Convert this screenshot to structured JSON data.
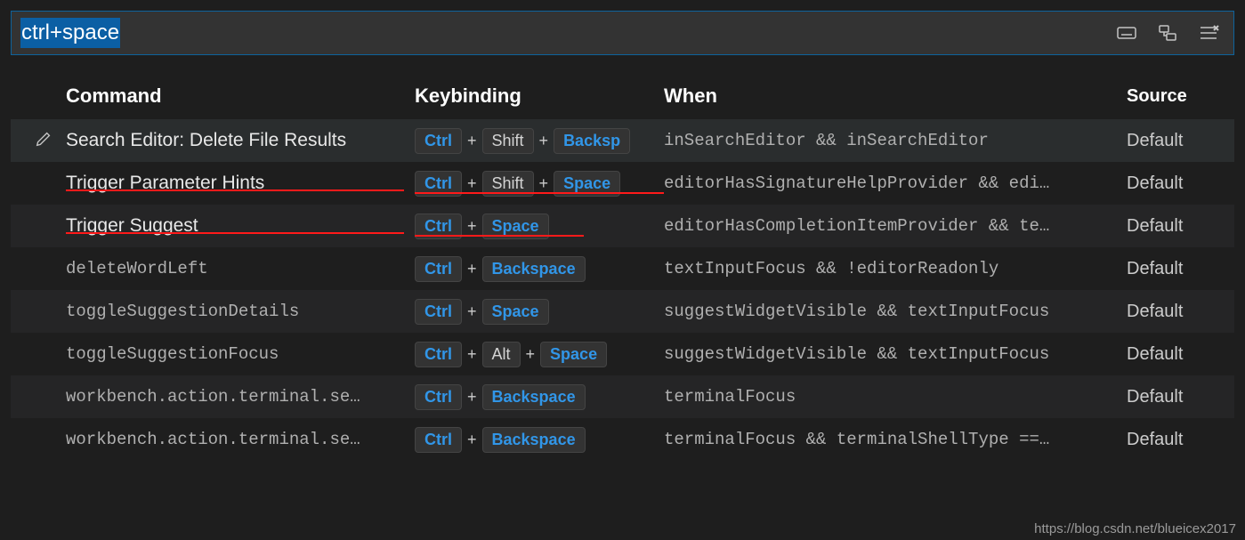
{
  "search": {
    "value": "ctrl+space"
  },
  "columns": {
    "command": "Command",
    "keybinding": "Keybinding",
    "when": "When",
    "source": "Source"
  },
  "rows": [
    {
      "command": "Search Editor: Delete File Results",
      "isId": false,
      "keys": [
        {
          "label": "Ctrl",
          "hl": true
        },
        {
          "label": "+",
          "plus": true
        },
        {
          "label": "Shift",
          "hl": false
        },
        {
          "label": "+",
          "plus": true
        },
        {
          "label": "Backsp",
          "hl": true
        }
      ],
      "when": "inSearchEditor && inSearchEditor",
      "source": "Default",
      "hovered": true,
      "underlineCmd": 0,
      "underlineKey": 0
    },
    {
      "command": "Trigger Parameter Hints",
      "isId": false,
      "keys": [
        {
          "label": "Ctrl",
          "hl": true
        },
        {
          "label": "+",
          "plus": true
        },
        {
          "label": "Shift",
          "hl": false
        },
        {
          "label": "+",
          "plus": true
        },
        {
          "label": "Space",
          "hl": true
        }
      ],
      "when": "editorHasSignatureHelpProvider && edi…",
      "source": "Default",
      "underlineCmd": 380,
      "underlineKey": 280
    },
    {
      "command": "Trigger Suggest",
      "isId": false,
      "keys": [
        {
          "label": "Ctrl",
          "hl": true
        },
        {
          "label": "+",
          "plus": true
        },
        {
          "label": "Space",
          "hl": true
        }
      ],
      "when": "editorHasCompletionItemProvider && te…",
      "source": "Default",
      "underlineCmd": 380,
      "underlineKey": 190
    },
    {
      "command": "deleteWordLeft",
      "isId": true,
      "keys": [
        {
          "label": "Ctrl",
          "hl": true
        },
        {
          "label": "+",
          "plus": true
        },
        {
          "label": "Backspace",
          "hl": true
        }
      ],
      "when": "textInputFocus && !editorReadonly",
      "source": "Default"
    },
    {
      "command": "toggleSuggestionDetails",
      "isId": true,
      "keys": [
        {
          "label": "Ctrl",
          "hl": true
        },
        {
          "label": "+",
          "plus": true
        },
        {
          "label": "Space",
          "hl": true
        }
      ],
      "when": "suggestWidgetVisible && textInputFocus",
      "source": "Default"
    },
    {
      "command": "toggleSuggestionFocus",
      "isId": true,
      "keys": [
        {
          "label": "Ctrl",
          "hl": true
        },
        {
          "label": "+",
          "plus": true
        },
        {
          "label": "Alt",
          "hl": false
        },
        {
          "label": "+",
          "plus": true
        },
        {
          "label": "Space",
          "hl": true
        }
      ],
      "when": "suggestWidgetVisible && textInputFocus",
      "source": "Default"
    },
    {
      "command": "workbench.action.terminal.se…",
      "isId": true,
      "keys": [
        {
          "label": "Ctrl",
          "hl": true
        },
        {
          "label": "+",
          "plus": true
        },
        {
          "label": "Backspace",
          "hl": true
        }
      ],
      "when": "terminalFocus",
      "source": "Default"
    },
    {
      "command": "workbench.action.terminal.se…",
      "isId": true,
      "keys": [
        {
          "label": "Ctrl",
          "hl": true
        },
        {
          "label": "+",
          "plus": true
        },
        {
          "label": "Backspace",
          "hl": true
        }
      ],
      "when": "terminalFocus && terminalShellType ==…",
      "source": "Default"
    }
  ],
  "watermark": "https://blog.csdn.net/blueicex2017"
}
